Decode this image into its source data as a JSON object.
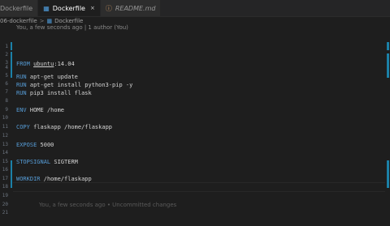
{
  "tabs": [
    {
      "label": "Dockerfile",
      "active": false,
      "icon": "docker-icon"
    },
    {
      "label": "Dockerfile",
      "active": true,
      "icon": "docker-icon",
      "close": "×"
    },
    {
      "label": "README.md",
      "active": false,
      "preview": true,
      "icon": "info-icon"
    }
  ],
  "breadcrumb": {
    "folder": "06-dockerfile",
    "separator": ">",
    "file": "Dockerfile"
  },
  "blame_header": "You, a few seconds ago | 1 author (You)",
  "line_numbers": [
    "1",
    "2",
    "3",
    "4",
    "5",
    "6",
    "7",
    "8",
    "9",
    "10",
    "11",
    "12",
    "13",
    "14",
    "15",
    "16",
    "17",
    "18",
    "19",
    "20",
    "21"
  ],
  "lines": {
    "l2_kw": "FROM",
    "l2_image": "ubuntu",
    "l2_tag": ":14.04",
    "l4_kw": "RUN",
    "l4_rest": " apt-get update",
    "l5_kw": "RUN",
    "l5_rest": " apt-get install python3-pip -y",
    "l6_kw": "RUN",
    "l6_rest": " pip3 install flask",
    "l8_kw": "ENV",
    "l8_rest": " HOME /home",
    "l10_kw": "COPY",
    "l10_rest": " flaskapp /home/flaskapp",
    "l12_kw": "EXPOSE",
    "l12_rest": " 5000",
    "l14_kw": "STOPSIGNAL",
    "l14_rest": " SIGTERM",
    "l16_kw": "WORKDIR",
    "l16_rest": " /home/flaskapp"
  },
  "inline_blame": "You, a few seconds ago • Uncommitted changes",
  "colors": {
    "keyword": "#569cd6",
    "gutter_modified": "#1b81a8",
    "background": "#1e1e1e"
  }
}
